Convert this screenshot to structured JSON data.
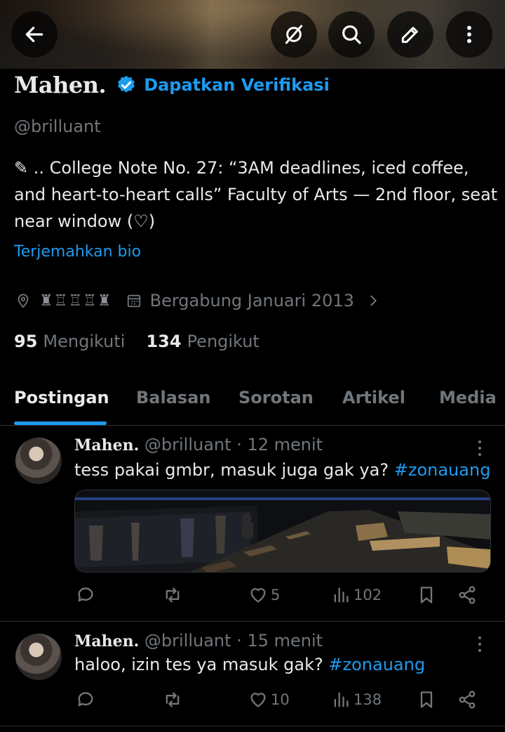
{
  "header": {
    "icons": [
      "back-arrow-icon",
      "grok-icon",
      "search-icon",
      "edit-icon",
      "more-vertical-icon"
    ]
  },
  "profile": {
    "name": "Mahen.",
    "verify_label": "Dapatkan Verifikasi",
    "handle": "@brilluant",
    "bio": "✎ .. College Note No. 27: “3AM deadlines, iced coffee, and heart-to-heart calls” Faculty of Arts — 2nd floor, seat near window (♡)",
    "translate_bio": "Terjemahkan bio",
    "location": "♜♖♖♖♜",
    "joined": "Bergabung Januari 2013",
    "following_count": "95",
    "following_label": "Mengikuti",
    "followers_count": "134",
    "followers_label": "Pengikut"
  },
  "tabs": [
    {
      "label": "Postingan",
      "active": true
    },
    {
      "label": "Balasan",
      "active": false
    },
    {
      "label": "Sorotan",
      "active": false
    },
    {
      "label": "Artikel",
      "active": false
    },
    {
      "label": "Media",
      "active": false
    }
  ],
  "tweets": [
    {
      "name": "Mahen.",
      "handle": "@brilluant",
      "time": "· 12 menit",
      "text": "tess pakai gmbr, masuk juga gak ya?",
      "hashtag": "#zonauang",
      "has_media": true,
      "likes": "5",
      "views": "102"
    },
    {
      "name": "Mahen.",
      "handle": "@brilluant",
      "time": "· 15 menit",
      "text": "haloo, izin tes ya masuk gak?",
      "hashtag": "#zonauang",
      "has_media": false,
      "likes": "10",
      "views": "138"
    }
  ],
  "colors": {
    "accent": "#1d9bf0",
    "muted": "#71767b",
    "text": "#e7e9ea",
    "background": "#000000",
    "divider": "#2f3336"
  }
}
